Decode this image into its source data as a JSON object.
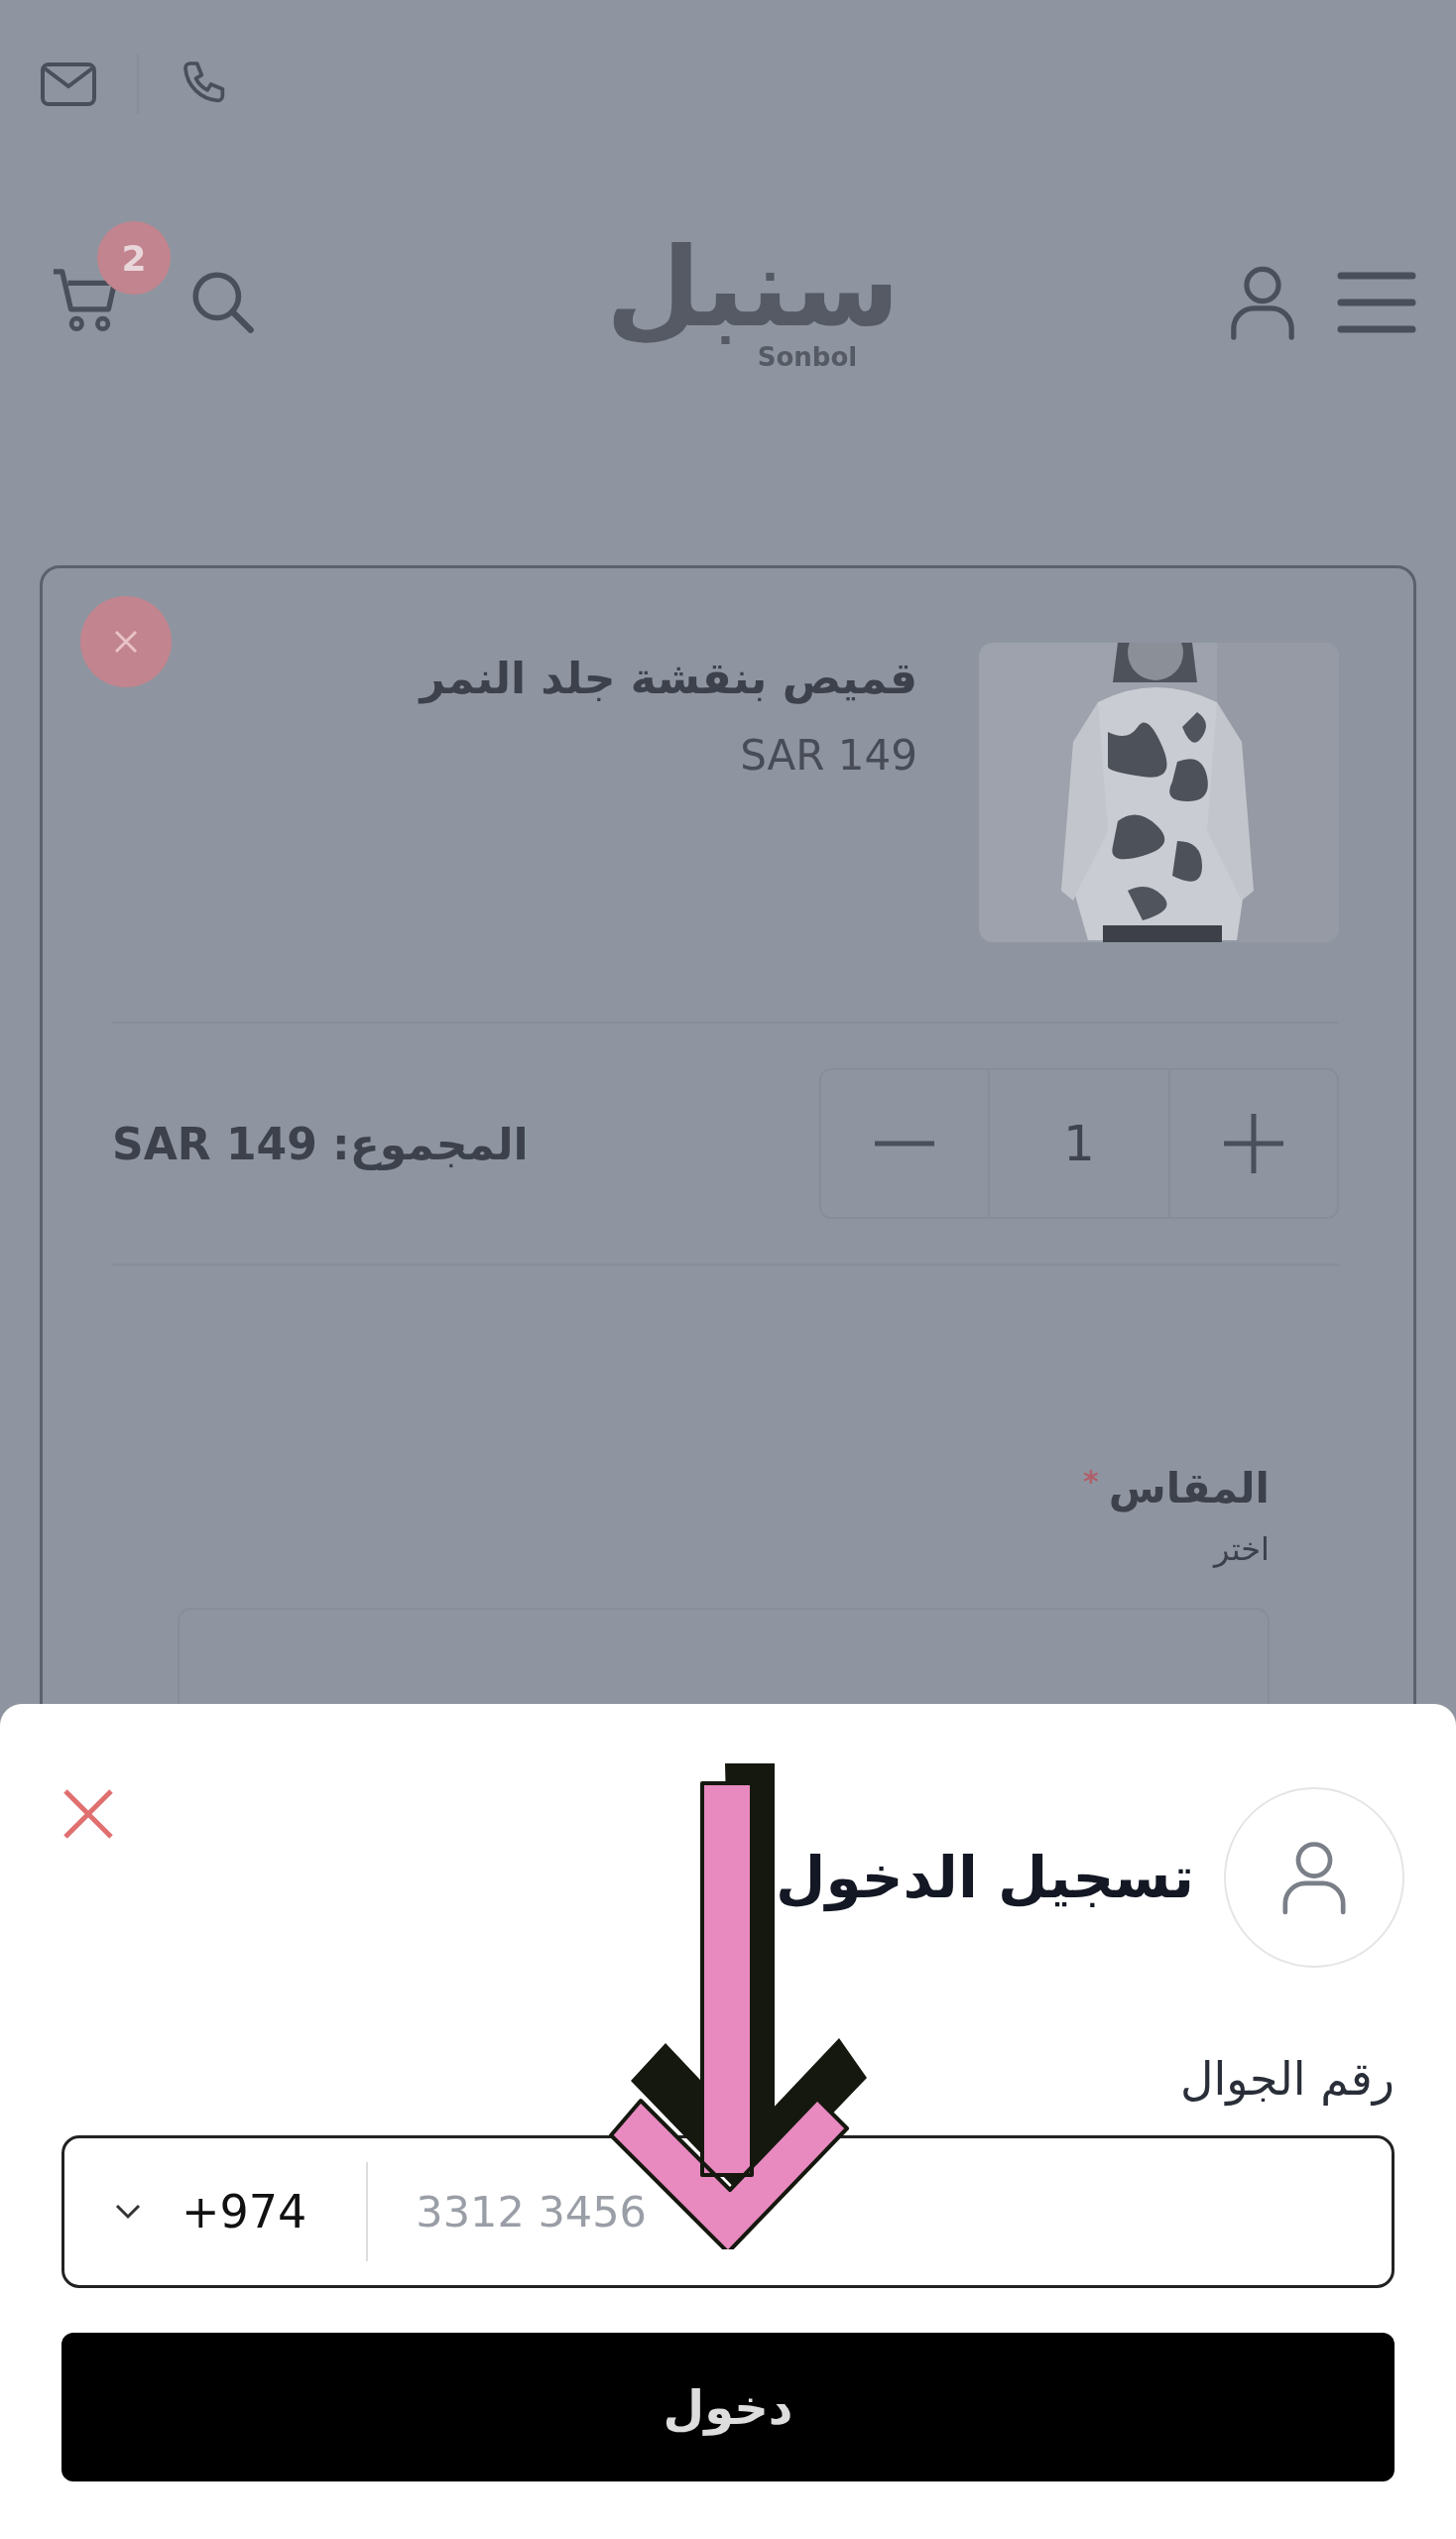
{
  "header": {
    "cart_count": "2",
    "logo": {
      "arabic": "سنبل",
      "latin": "Sonbol"
    }
  },
  "cart_item": {
    "name": "قميص بنقشة جلد النمر",
    "price": "SAR 149",
    "quantity": "1",
    "total": "المجموع: SAR 149"
  },
  "size_field": {
    "label": "المقاس",
    "required_mark": "*",
    "hint": "اختر"
  },
  "login_sheet": {
    "title": "تسجيل الدخول",
    "phone_label": "رقم الجوال",
    "country_code": "+974",
    "placeholder": "3312 3456",
    "submit": "دخول"
  }
}
